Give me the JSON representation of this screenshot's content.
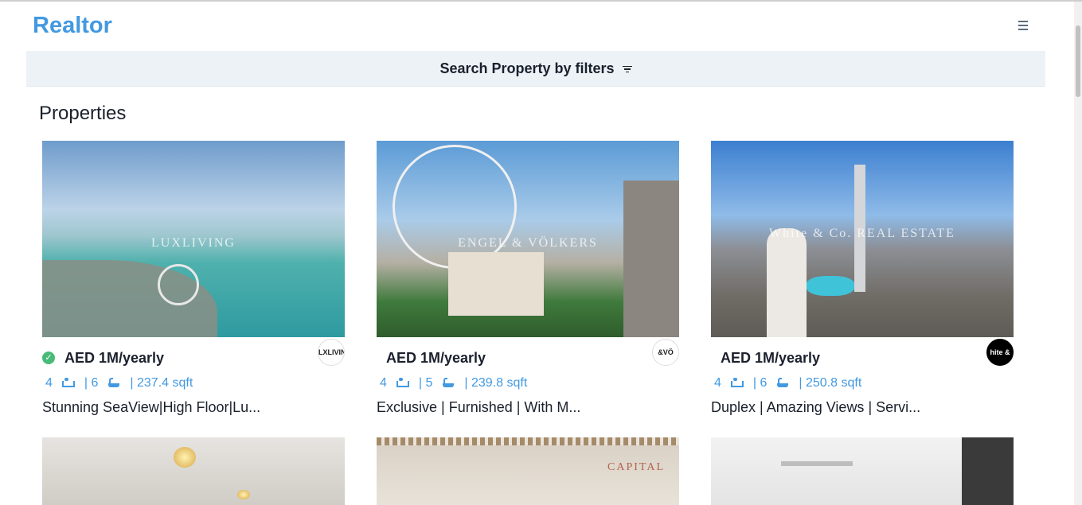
{
  "header": {
    "brand": "Realtor",
    "menu_icon": "hamburger-icon"
  },
  "filter_bar": {
    "label": "Search Property by filters",
    "icon": "filter-icon"
  },
  "section": {
    "title": "Properties"
  },
  "listings": [
    {
      "price": "AED 1M/yearly",
      "verified": true,
      "agency_logo_text": "LXLIVIN",
      "rooms": "4",
      "baths": "| 6",
      "area": "| 237.4 sqft",
      "title": "Stunning SeaView|High Floor|Lu...",
      "watermark": "LUXLIVING"
    },
    {
      "price": "AED 1M/yearly",
      "verified": false,
      "agency_logo_text": "&VÖ",
      "rooms": "4",
      "baths": "| 5",
      "area": "| 239.8 sqft",
      "title": "Exclusive | Furnished | With M...",
      "watermark": "ENGEL & VÖLKERS"
    },
    {
      "price": "AED 1M/yearly",
      "verified": false,
      "agency_logo_text": "hite & C",
      "rooms": "4",
      "baths": "| 6",
      "area": "| 250.8 sqft",
      "title": "Duplex | Amazing Views | Servi...",
      "watermark": "White & Co. REAL ESTATE"
    }
  ],
  "more_listings_watermarks": [
    "",
    "CAPITAL",
    ""
  ],
  "colors": {
    "accent": "#4299e1",
    "verified": "#48bb78",
    "filter_bg": "#edf2f7"
  }
}
